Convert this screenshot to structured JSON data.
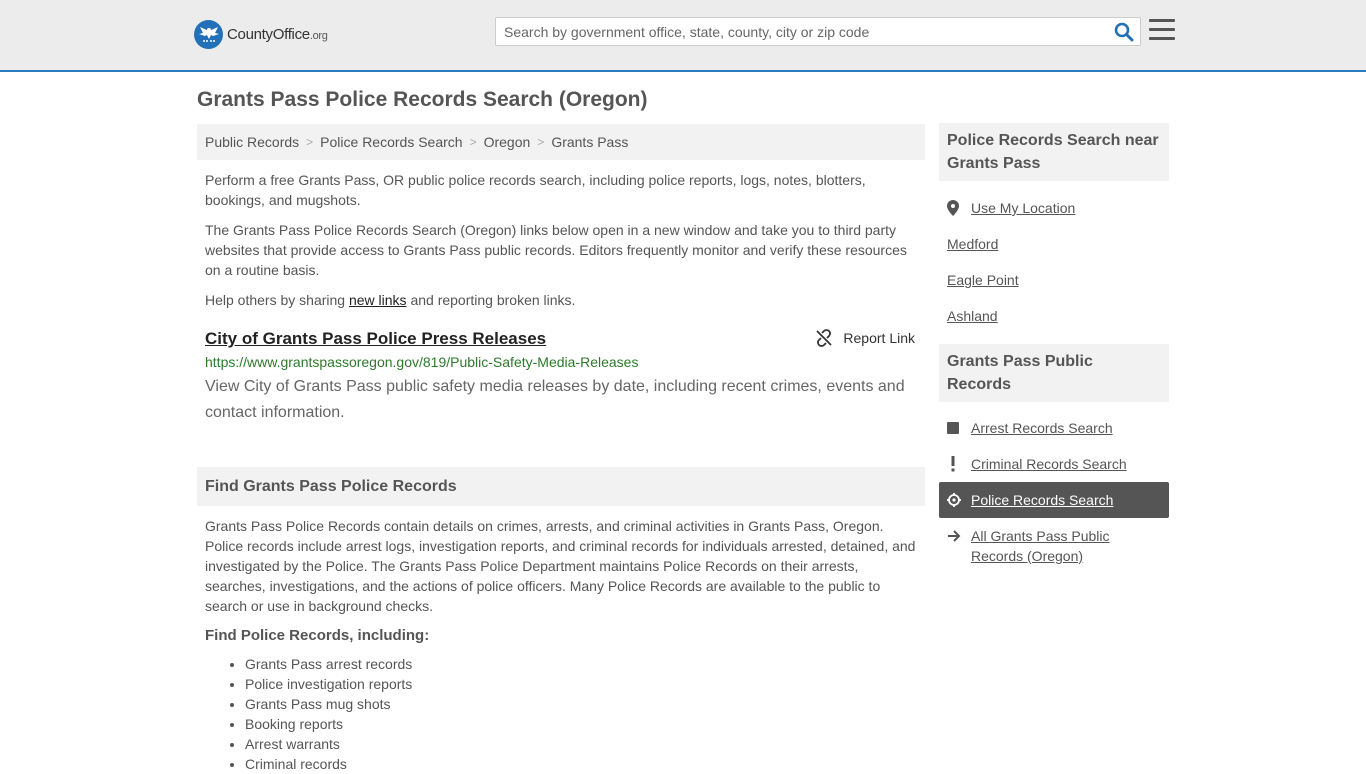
{
  "header": {
    "logo_name": "CountyOffice",
    "logo_tld": ".org",
    "search_placeholder": "Search by government office, state, county, city or zip code"
  },
  "page": {
    "title": "Grants Pass Police Records Search (Oregon)"
  },
  "breadcrumb": [
    "Public Records",
    "Police Records Search",
    "Oregon",
    "Grants Pass"
  ],
  "intro": {
    "p1": "Perform a free Grants Pass, OR public police records search, including police reports, logs, notes, blotters, bookings, and mugshots.",
    "p2": "The Grants Pass Police Records Search (Oregon) links below open in a new window and take you to third party websites that provide access to Grants Pass public records. Editors frequently monitor and verify these resources on a routine basis.",
    "p3_before": "Help others by sharing ",
    "p3_link": "new links",
    "p3_after": " and reporting broken links."
  },
  "result": {
    "title": "City of Grants Pass Police Press Releases",
    "report_label": "Report Link",
    "url": "https://www.grantspassoregon.gov/819/Public-Safety-Media-Releases",
    "description": "View City of Grants Pass public safety media releases by date, including recent crimes, events and contact information."
  },
  "find": {
    "heading": "Find Grants Pass Police Records",
    "body": "Grants Pass Police Records contain details on crimes, arrests, and criminal activities in Grants Pass, Oregon. Police records include arrest logs, investigation reports, and criminal records for individuals arrested, detained, and investigated by the Police. The Grants Pass Police Department maintains Police Records on their arrests, searches, investigations, and the actions of police officers. Many Police Records are available to the public to search or use in background checks.",
    "subheading": "Find Police Records, including:",
    "items": [
      "Grants Pass arrest records",
      "Police investigation reports",
      "Grants Pass mug shots",
      "Booking reports",
      "Arrest warrants",
      "Criminal records"
    ]
  },
  "sidebar": {
    "near_heading": "Police Records Search near Grants Pass",
    "use_location": "Use My Location",
    "nearby": [
      "Medford",
      "Eagle Point",
      "Ashland"
    ],
    "public_heading": "Grants Pass Public Records",
    "links": [
      {
        "label": "Arrest Records Search",
        "icon": "square-icon"
      },
      {
        "label": "Criminal Records Search",
        "icon": "exclamation-icon"
      },
      {
        "label": "Police Records Search",
        "icon": "crosshair-icon"
      },
      {
        "label": "All Grants Pass Public Records (Oregon)",
        "icon": "arrow-right-icon"
      }
    ]
  },
  "colors": {
    "accent": "#2b7bc0",
    "url_green": "#2d7a2d",
    "active_bg": "#555555"
  }
}
